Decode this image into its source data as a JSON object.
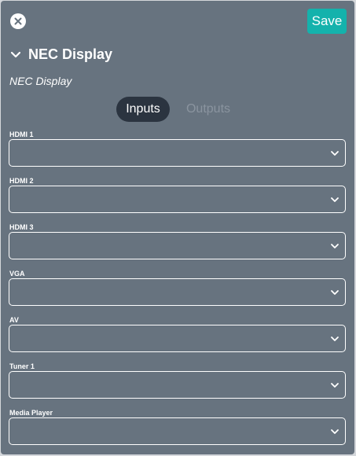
{
  "header": {
    "close_icon": "close-circle-icon",
    "save_label": "Save"
  },
  "section": {
    "title": "NEC Display",
    "subtitle": "NEC Display",
    "expand_icon": "chevron-down-icon"
  },
  "tabs": {
    "active": "Inputs",
    "items": [
      "Inputs",
      "Outputs"
    ]
  },
  "fields": [
    {
      "label": "HDMI 1",
      "value": ""
    },
    {
      "label": "HDMI 2",
      "value": ""
    },
    {
      "label": "HDMI 3",
      "value": ""
    },
    {
      "label": "VGA",
      "value": ""
    },
    {
      "label": "AV",
      "value": ""
    },
    {
      "label": "Tuner 1",
      "value": ""
    },
    {
      "label": "Media Player",
      "value": ""
    }
  ],
  "colors": {
    "panel": "#67737f",
    "accent": "#14b2ac",
    "active_tab": "#2b3440",
    "inactive_tab_text": "#8a949f"
  }
}
